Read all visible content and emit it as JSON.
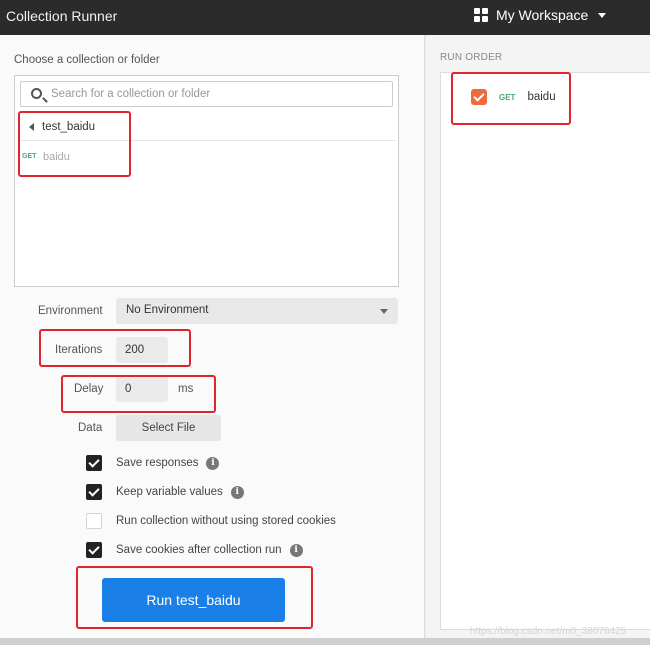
{
  "app": {
    "title": "Collection Runner"
  },
  "workspace": {
    "label": "My Workspace",
    "icon": "grid-icon"
  },
  "collection_picker": {
    "heading": "Choose a collection or folder",
    "search": {
      "placeholder": "Search for a collection or folder",
      "value": ""
    },
    "collection": {
      "name": "test_baidu"
    },
    "requests": [
      {
        "method": "GET",
        "name": "baidu"
      }
    ]
  },
  "settings": {
    "environment": {
      "label": "Environment",
      "value": "No Environment"
    },
    "iterations": {
      "label": "Iterations",
      "value": "200"
    },
    "delay": {
      "label": "Delay",
      "value": "0",
      "unit": "ms"
    },
    "data": {
      "label": "Data",
      "button_label": "Select File"
    },
    "checkboxes": [
      {
        "label": "Save responses",
        "checked": true,
        "info": true
      },
      {
        "label": "Keep variable values",
        "checked": true,
        "info": true
      },
      {
        "label": "Run collection without using stored cookies",
        "checked": false,
        "info": false
      },
      {
        "label": "Save cookies after collection run",
        "checked": true,
        "info": true
      }
    ],
    "run_button_label": "Run test_baidu"
  },
  "run_order": {
    "title": "RUN ORDER",
    "items": [
      {
        "method": "GET",
        "name": "baidu",
        "checked": true
      }
    ]
  },
  "watermark": "https://blog.csdn.net/m0_38076425",
  "colors": {
    "accent_blue": "#1b7fe8",
    "annotation_red": "#e0262c",
    "get_green": "#46a86e",
    "checkbox_orange": "#ef6a3c"
  }
}
